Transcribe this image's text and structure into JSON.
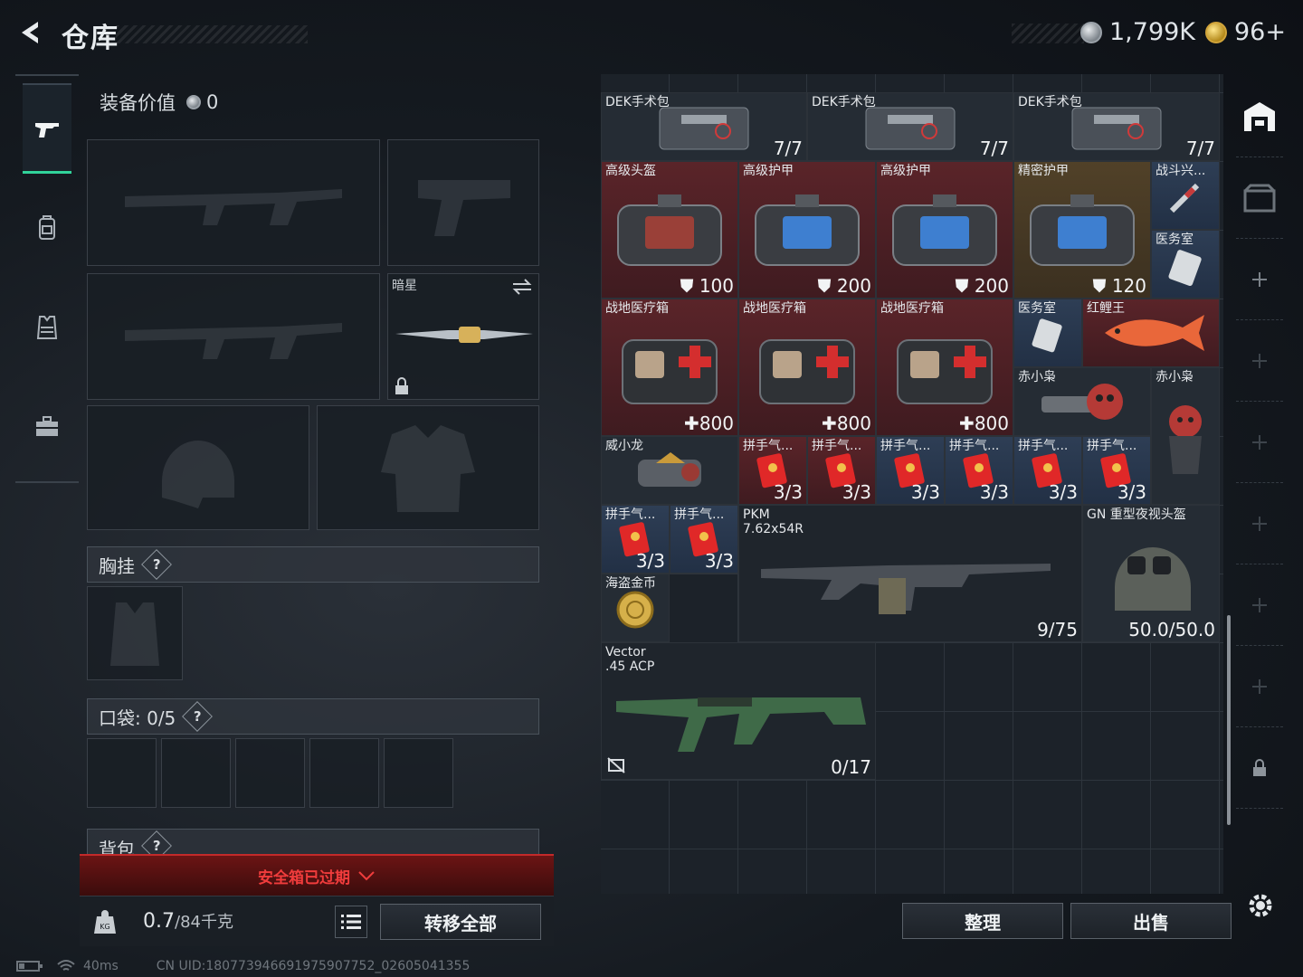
{
  "header": {
    "title": "仓库",
    "currency1": "1,799K",
    "currency2": "96+"
  },
  "equipment": {
    "title": "装备价值",
    "value": "0",
    "secondary_slot_label": "暗星",
    "chest_label": "胸挂",
    "pocket_label": "口袋: 0/5",
    "backpack_label": "背包",
    "help": "?",
    "safebox": "安全箱已过期",
    "weight_value": "0.7",
    "weight_max": "/84千克",
    "transfer_all": "转移全部"
  },
  "inventory": {
    "row0": [
      {
        "name": "DEK手术包",
        "val": "7/7"
      },
      {
        "name": "DEK手术包",
        "val": "7/7"
      },
      {
        "name": "DEK手术包",
        "val": "7/7"
      }
    ],
    "armor": [
      {
        "name": "高级头盔",
        "val": "100"
      },
      {
        "name": "高级护甲",
        "val": "200"
      },
      {
        "name": "高级护甲",
        "val": "200"
      },
      {
        "name": "精密护甲",
        "val": "120"
      }
    ],
    "side1": {
      "name": "战斗兴..."
    },
    "side2": {
      "name": "医务室"
    },
    "medkits": [
      {
        "name": "战地医疗箱",
        "val": "800"
      },
      {
        "name": "战地医疗箱",
        "val": "800"
      },
      {
        "name": "战地医疗箱",
        "val": "800"
      }
    ],
    "yiwushi2": {
      "name": "医务室"
    },
    "carp": {
      "name": "红鲤王"
    },
    "owl1": {
      "name": "赤小枭"
    },
    "owl2": {
      "name": "赤小枭"
    },
    "dragon": {
      "name": "威小龙"
    },
    "envelopes": [
      {
        "name": "拼手气...",
        "val": "3/3"
      },
      {
        "name": "拼手气...",
        "val": "3/3"
      },
      {
        "name": "拼手气...",
        "val": "3/3"
      },
      {
        "name": "拼手气...",
        "val": "3/3"
      },
      {
        "name": "拼手气...",
        "val": "3/3"
      },
      {
        "name": "拼手气...",
        "val": "3/3"
      }
    ],
    "envelopes2": [
      {
        "name": "拼手气...",
        "val": "3/3"
      },
      {
        "name": "拼手气...",
        "val": "3/3"
      }
    ],
    "pkm": {
      "name": "PKM",
      "sub": "7.62x54R",
      "val": "9/75"
    },
    "nvg": {
      "name": "GN 重型夜视头盔",
      "val": "50.0/50.0"
    },
    "coin": {
      "name": "海盗金币"
    },
    "vector": {
      "name": "Vector",
      "sub": ".45 ACP",
      "val": "0/17"
    }
  },
  "actions": {
    "sort": "整理",
    "sell": "出售"
  },
  "status": {
    "ping": "40ms",
    "uid": "CN UID:180773946691975907752_02605041355"
  },
  "colors": {
    "accent_green": "#31d39a",
    "safebox_red": "#f03c3c",
    "armor_red_bg": "#5a2429",
    "blue_bg": "#2e3e55"
  }
}
